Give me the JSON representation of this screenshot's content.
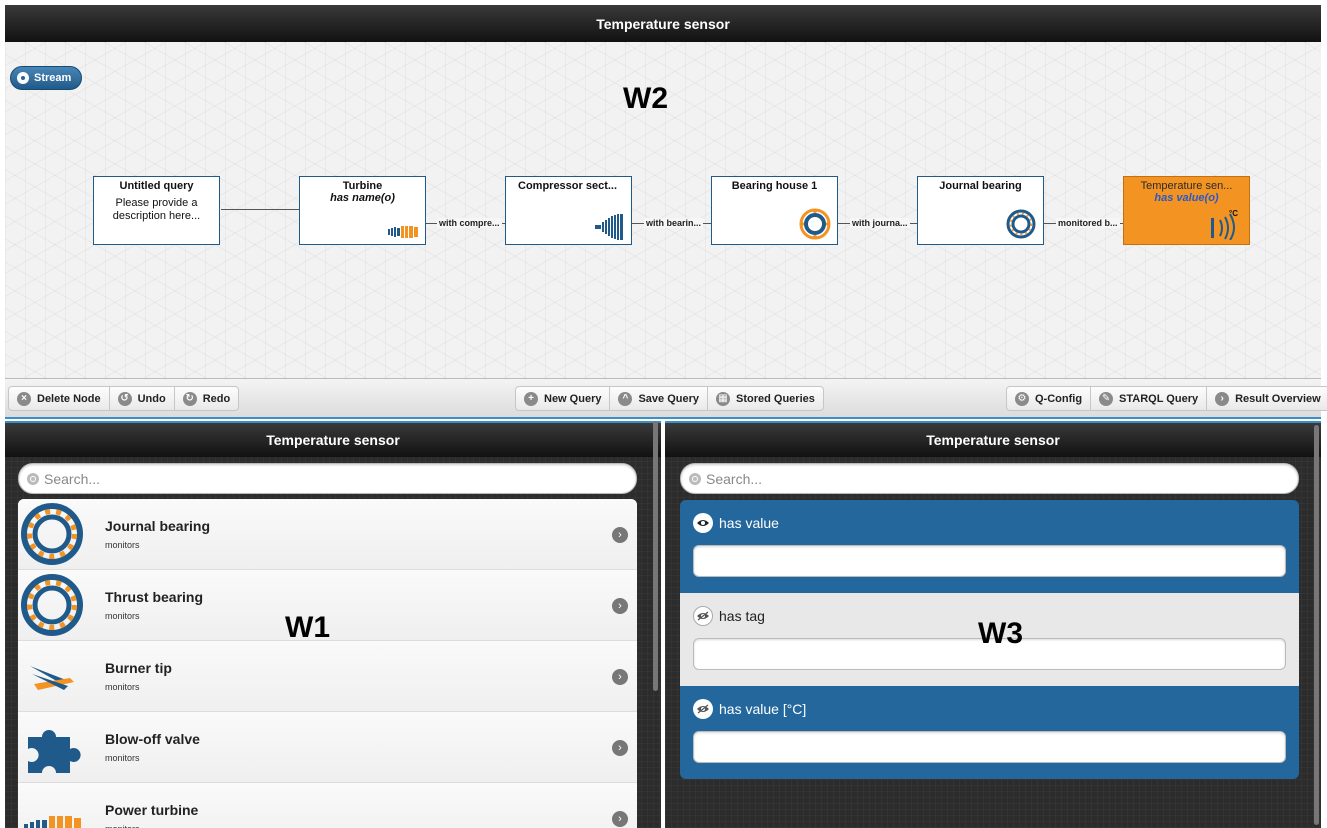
{
  "header": {
    "title": "Temperature sensor"
  },
  "canvas": {
    "stream_label": "Stream",
    "w_label": "W2",
    "nodes": [
      {
        "title": "Untitled query",
        "description": "Please provide a description here..."
      },
      {
        "title": "Turbine",
        "sub": "has name(o)"
      },
      {
        "title": "Compressor sect..."
      },
      {
        "title": "Bearing house 1"
      },
      {
        "title": "Journal bearing"
      },
      {
        "title": "Temperature sen...",
        "sub": "has value(o)"
      }
    ],
    "edges": [
      "with compre...",
      "with bearin...",
      "with journa...",
      "monitored b..."
    ]
  },
  "toolbar": {
    "delete_node": "Delete Node",
    "undo": "Undo",
    "redo": "Redo",
    "new_query": "New Query",
    "save_query": "Save Query",
    "stored_queries": "Stored Queries",
    "q_config": "Q-Config",
    "starql_query": "STARQL Query",
    "result_overview": "Result Overview"
  },
  "left_panel": {
    "title": "Temperature sensor",
    "search_placeholder": "Search...",
    "w_label": "W1",
    "items": [
      {
        "label": "Journal bearing",
        "sub": "monitors",
        "icon": "bearing-icon"
      },
      {
        "label": "Thrust bearing",
        "sub": "monitors",
        "icon": "bearing-icon"
      },
      {
        "label": "Burner tip",
        "sub": "monitors",
        "icon": "burner-tip-icon"
      },
      {
        "label": "Blow-off valve",
        "sub": "monitors",
        "icon": "puzzle-icon"
      },
      {
        "label": "Power turbine",
        "sub": "monitors",
        "icon": "turbine-icon"
      }
    ]
  },
  "right_panel": {
    "title": "Temperature sensor",
    "search_placeholder": "Search...",
    "w_label": "W3",
    "properties": [
      {
        "label": "has value",
        "value": ""
      },
      {
        "label": "has tag",
        "value": ""
      },
      {
        "label": "has value [°C]",
        "value": ""
      }
    ]
  },
  "colors": {
    "accent_blue": "#23679d",
    "selected_orange": "#f39322",
    "header_dark": "#1a1a1a"
  }
}
